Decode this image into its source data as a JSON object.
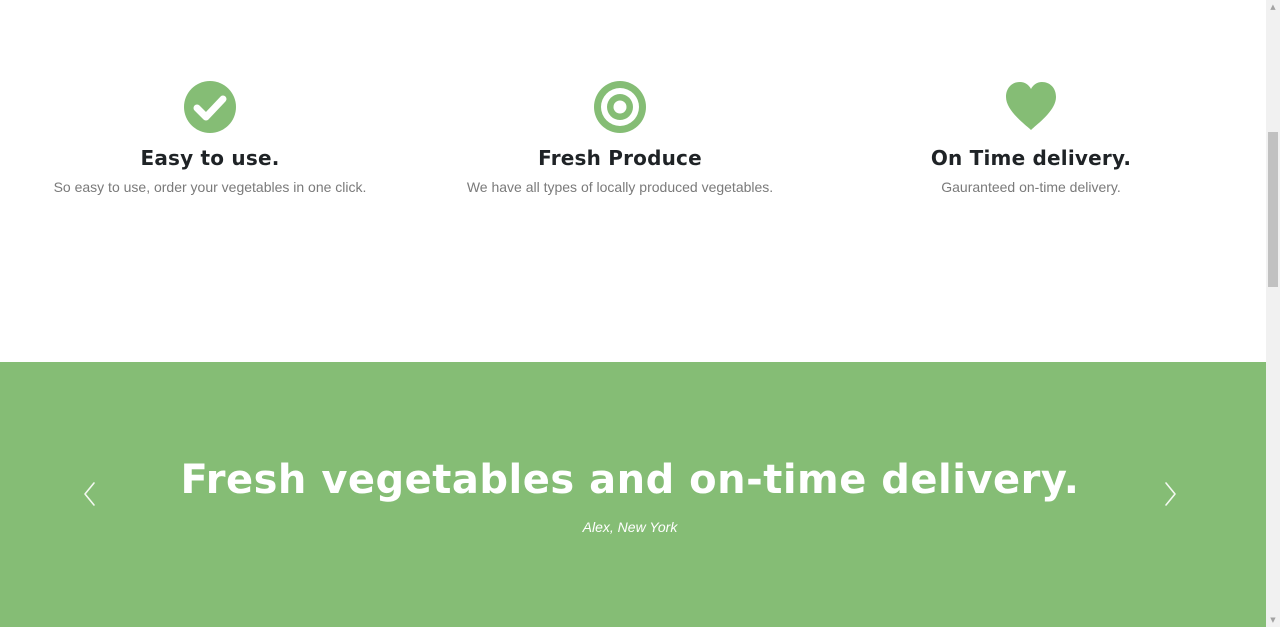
{
  "colors": {
    "accent": "#85bd75",
    "heading": "#1f2326",
    "muted": "#7a7a7a"
  },
  "features": [
    {
      "icon": "check-circle-icon",
      "title": "Easy to use.",
      "description": "So easy to use, order your vegetables in one click."
    },
    {
      "icon": "bullseye-icon",
      "title": "Fresh Produce",
      "description": "We have all types of locally produced vegetables."
    },
    {
      "icon": "heart-icon",
      "title": "On Time delivery.",
      "description": "Gauranteed on-time delivery."
    }
  ],
  "testimonial": {
    "quote": "Fresh vegetables and on-time delivery.",
    "author": "Alex, New York",
    "prev_icon": "chevron-left-icon",
    "next_icon": "chevron-right-icon"
  }
}
